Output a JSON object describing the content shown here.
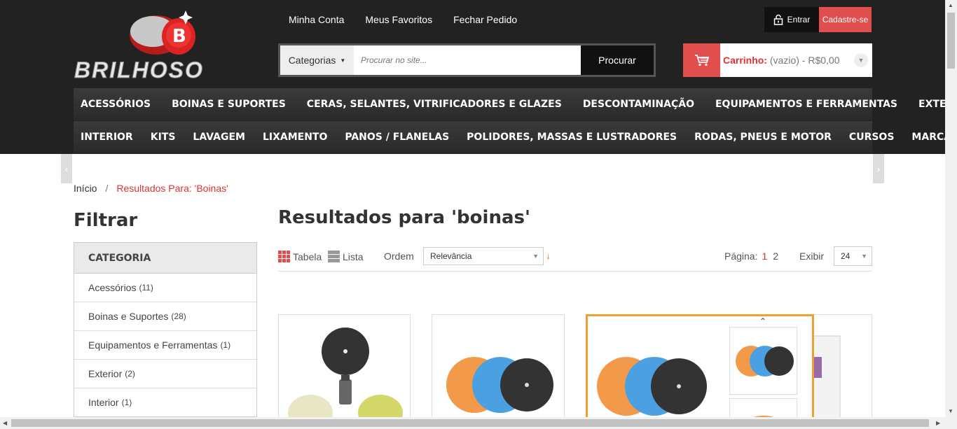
{
  "brand": {
    "name": "BRILHOSO",
    "logo_letter": "B"
  },
  "top_links": [
    "Minha Conta",
    "Meus Favoritos",
    "Fechar Pedido"
  ],
  "account": {
    "login": "Entrar",
    "signup": "Cadastre-se"
  },
  "search": {
    "category": "Categorias",
    "placeholder": "Procurar no site...",
    "button": "Procurar"
  },
  "cart": {
    "label": "Carrinho:",
    "status": "(vazio) - R$0,00"
  },
  "nav_row1": [
    "ACESSÓRIOS",
    "BOINAS E SUPORTES",
    "CERAS, SELANTES, VITRIFICADORES E GLAZES",
    "DESCONTAMINAÇÃO",
    "EQUIPAMENTOS E FERRAMENTAS",
    "EXTERIOR"
  ],
  "nav_row2": [
    "INTERIOR",
    "KITS",
    "LAVAGEM",
    "LIXAMENTO",
    "PANOS / FLANELAS",
    "POLIDORES, MASSAS E LUSTRADORES",
    "RODAS, PNEUS E MOTOR",
    "CURSOS",
    "MARCAS"
  ],
  "breadcrumb": {
    "home": "Início",
    "separator": "/",
    "current": "Resultados Para: 'Boinas'"
  },
  "filter": {
    "title": "Filtrar",
    "category_header": "CATEGORIA",
    "items": [
      {
        "label": "Acessórios",
        "count": "(11)"
      },
      {
        "label": "Boinas e Suportes",
        "count": "(28)"
      },
      {
        "label": "Equipamentos e Ferramentas",
        "count": "(1)"
      },
      {
        "label": "Exterior",
        "count": "(2)"
      },
      {
        "label": "Interior",
        "count": "(1)"
      }
    ]
  },
  "results": {
    "title": "Resultados para 'boinas'",
    "view_table": "Tabela",
    "view_list": "Lista",
    "order_label": "Ordem",
    "order_value": "Relevância",
    "page_label": "Página:",
    "page_current": "1",
    "page_next": "2",
    "show_label": "Exibir",
    "show_value": "24"
  },
  "colors": {
    "accent": "#e04e4e",
    "header_bg": "#222222",
    "highlight_border": "#f0a030"
  }
}
